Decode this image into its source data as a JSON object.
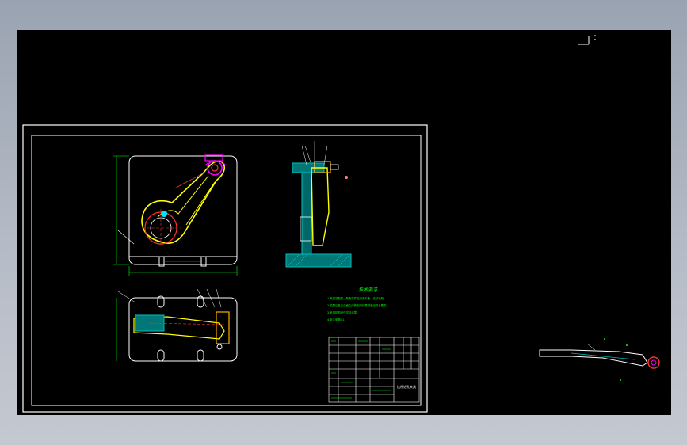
{
  "app": {
    "viewport_label": "CAD drawing viewport"
  },
  "drawing": {
    "notes_title": "技术要求",
    "notes": [
      "1.夹具装配前，所有零件应清洗干净，去除毛刺。",
      "2.装配后各定位面之间的相对位置精度应符合要求。",
      "3.夹紧机构动作灵活可靠。",
      "4.未注倒角C1。"
    ],
    "title_block": {
      "title": "连杆钻孔夹具"
    }
  },
  "colors": {
    "background": "#000000",
    "frame": "#ffffff",
    "part": "#ffff00",
    "dimension": "#00ff00",
    "hatch": "#00b8b8",
    "accent": "#ff00ff",
    "red": "#ff3030"
  }
}
